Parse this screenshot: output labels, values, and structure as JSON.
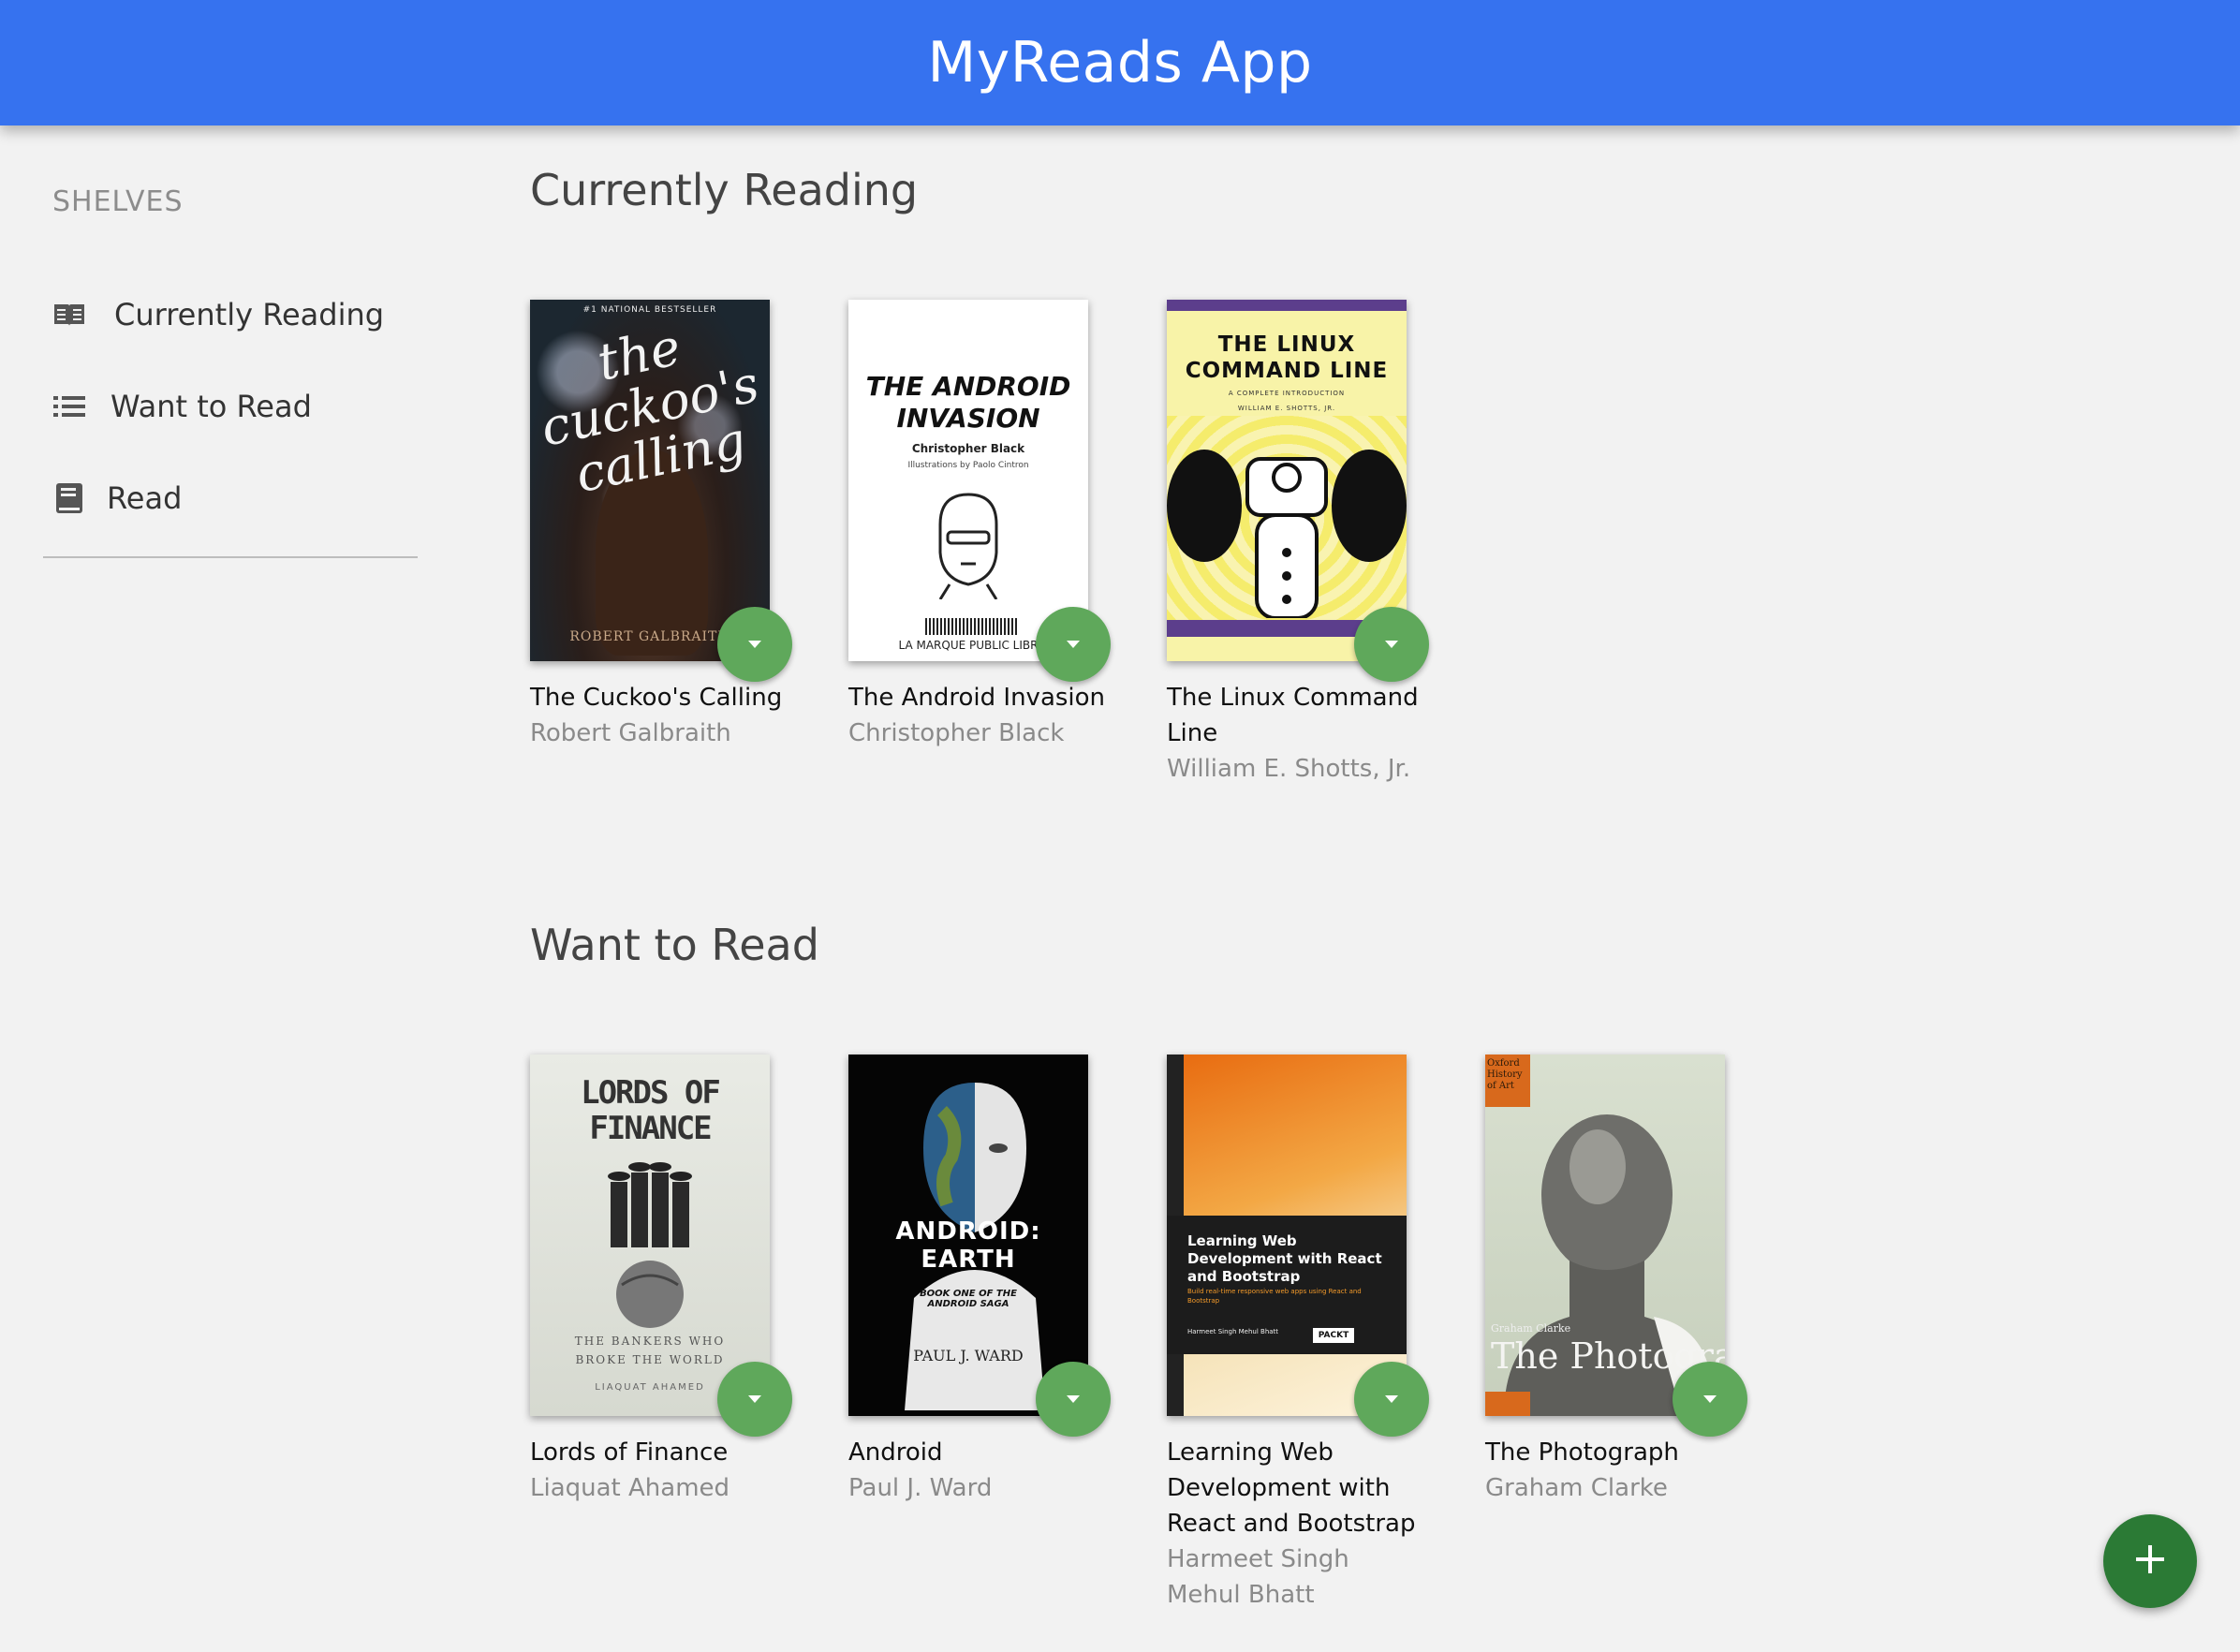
{
  "header": {
    "title": "MyReads App"
  },
  "sidebar": {
    "heading": "SHELVES",
    "items": [
      {
        "label": "Currently Reading",
        "icon": "open-book-icon"
      },
      {
        "label": "Want to Read",
        "icon": "list-icon"
      },
      {
        "label": "Read",
        "icon": "book-icon"
      }
    ]
  },
  "shelves": [
    {
      "title": "Currently Reading",
      "books": [
        {
          "title": "The Cuckoo's Calling",
          "authors": [
            "Robert Galbraith"
          ],
          "cover": {
            "top_text": "#1 NATIONAL BESTSELLER",
            "main_text": "the cuckoo's calling",
            "author_text": "ROBERT GALBRAITH"
          }
        },
        {
          "title": "The Android Invasion",
          "authors": [
            "Christopher Black"
          ],
          "cover": {
            "main_text": "THE ANDROID INVASION",
            "author_text": "Christopher Black",
            "sub_text": "Illustrations by Paolo Cintron",
            "bottom_text": "LA MARQUE PUBLIC LIBR"
          }
        },
        {
          "title": "The Linux Command Line",
          "authors": [
            "William E. Shotts, Jr."
          ],
          "cover": {
            "main_text": "THE LINUX COMMAND LINE",
            "sub_text": "A COMPLETE INTRODUCTION",
            "author_text": "WILLIAM E. SHOTTS, JR."
          }
        }
      ]
    },
    {
      "title": "Want to Read",
      "books": [
        {
          "title": "Lords of Finance",
          "authors": [
            "Liaquat Ahamed"
          ],
          "cover": {
            "main_text": "LORDS OF FINANCE",
            "sub_text": "THE BANKERS WHO BROKE THE WORLD",
            "author_text": "LIAQUAT AHAMED"
          }
        },
        {
          "title": "Android",
          "authors": [
            "Paul J. Ward"
          ],
          "cover": {
            "main_text": "ANDROID: EARTH",
            "sub_text": "BOOK ONE OF THE ANDROID SAGA",
            "author_text": "PAUL J. WARD"
          }
        },
        {
          "title": "Learning Web Development with React and Bootstrap",
          "authors": [
            "Harmeet Singh",
            "Mehul Bhatt"
          ],
          "cover": {
            "main_text": "Learning Web Development with React and Bootstrap",
            "sub_text": "Build real-time responsive web apps using React and Bootstrap",
            "author_text": "Harmeet Singh Mehul Bhatt",
            "badge_text": "PACKT"
          }
        },
        {
          "title": "The Photograph",
          "authors": [
            "Graham Clarke"
          ],
          "cover": {
            "top_text": "Oxford History of Art",
            "main_text": "The Photograph",
            "author_text": "Graham Clarke"
          }
        }
      ]
    }
  ],
  "add_button": {
    "icon": "plus-icon"
  },
  "colors": {
    "header": "#3672ef",
    "shelf_changer": "#5fa85b",
    "add_button": "#2b7a35",
    "background": "#f2f2f2"
  }
}
